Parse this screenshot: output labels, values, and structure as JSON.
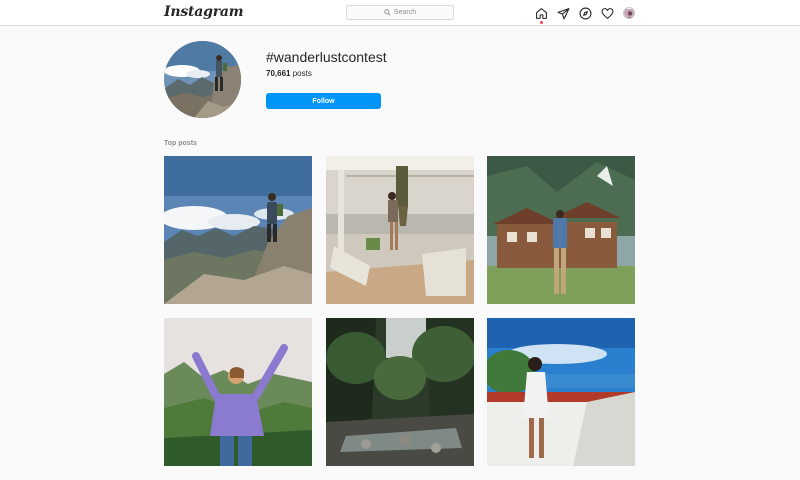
{
  "header": {
    "logo": "Instagram",
    "search_placeholder": "Search",
    "nav_icons": [
      "home-icon",
      "direct-icon",
      "explore-icon",
      "activity-icon",
      "profile-avatar"
    ]
  },
  "hashtag": {
    "name": "#wanderlustcontest",
    "posts_count": "70,661",
    "posts_label": "posts",
    "follow_label": "Follow"
  },
  "top_posts": {
    "label": "Top posts"
  },
  "colors": {
    "accent": "#0095f6",
    "notification_dot": "#ed4956",
    "border": "#dbdbdb",
    "background": "#fafafa"
  }
}
